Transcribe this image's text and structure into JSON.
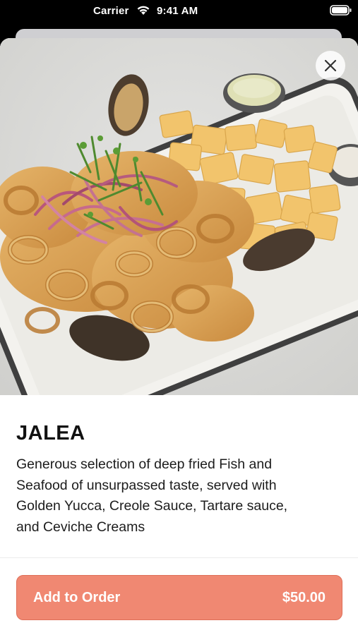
{
  "status_bar": {
    "carrier": "Carrier",
    "time": "9:41 AM",
    "icons": [
      "wifi-icon",
      "battery-icon"
    ]
  },
  "product": {
    "name": "JALEA",
    "description": "Generous selection of deep fried Fish and Seafood of unsurpassed taste, served with Golden Yucca, Creole Sauce, Tartare sauce, and Ceviche Creams",
    "image": "fried-seafood-platter"
  },
  "actions": {
    "close_icon": "close-icon",
    "add_label": "Add to Order",
    "price": "$50.00"
  },
  "colors": {
    "accent": "#f08872",
    "accent_border": "#de6f59",
    "text": "#111111"
  }
}
